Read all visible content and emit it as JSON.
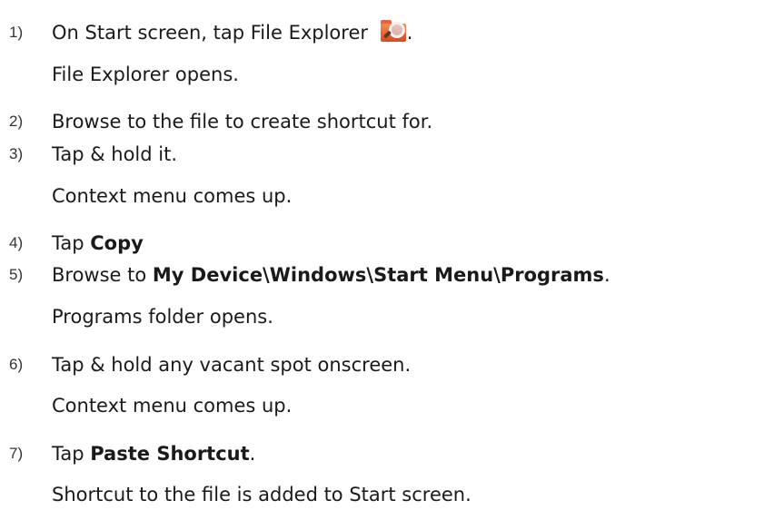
{
  "steps": [
    {
      "number": "1)",
      "parts": [
        "On Start screen, tap File Explorer ",
        "."
      ],
      "icon": "file-explorer-icon",
      "note": "File Explorer opens."
    },
    {
      "number": "2)",
      "parts": [
        "Browse to the file to create shortcut for."
      ]
    },
    {
      "number": "3)",
      "parts": [
        "Tap & hold it."
      ],
      "note": "Context menu comes up."
    },
    {
      "number": "4)",
      "parts": [
        "Tap ",
        "Copy"
      ]
    },
    {
      "number": "5)",
      "parts": [
        "Browse to ",
        "My Device\\Windows\\Start Menu\\Programs",
        "."
      ],
      "note": "Programs folder opens."
    },
    {
      "number": "6)",
      "parts": [
        "Tap & hold any vacant spot onscreen."
      ],
      "note": "Context menu comes up."
    },
    {
      "number": "7)",
      "parts": [
        "Tap ",
        "Paste Shortcut",
        "."
      ],
      "note": "Shortcut to the file is added to Start screen."
    }
  ],
  "colors": {
    "text": "#1a1a1a",
    "icon": "#e8643a"
  }
}
